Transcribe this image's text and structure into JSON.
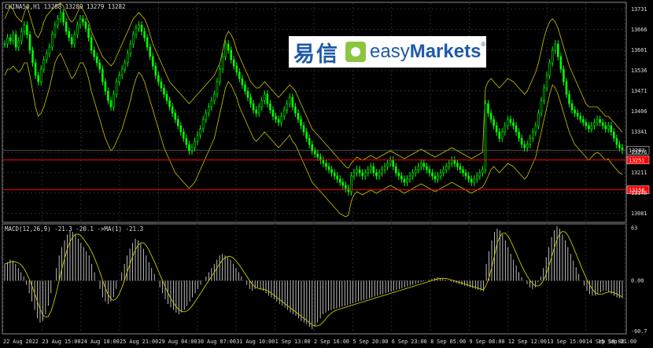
{
  "header": {
    "symbol_info": "CHINA50,H1  13288 13289 13279 13282"
  },
  "macd": {
    "label": "MACD(12,26,9) -21.3 -20.1  ->MA(1) -21.3",
    "ticks": [
      "63",
      "0.00",
      "-60.7"
    ]
  },
  "price_axis": {
    "ticks": [
      "13731",
      "13666",
      "13601",
      "13536",
      "13471",
      "13406",
      "13341",
      "13276",
      "13211",
      "13146",
      "13081"
    ],
    "current_price": "13282",
    "level_1": "13251",
    "level_2": "13156"
  },
  "time_axis": [
    "22 Aug 2022",
    "23 Aug 15:00",
    "24 Aug 18:00",
    "25 Aug 21:00",
    "29 Aug 04:00",
    "30 Aug 07:00",
    "31 Aug 10:00",
    "1 Sep 13:00",
    "2 Sep 16:00",
    "5 Sep 20:00",
    "6 Sep 23:00",
    "8 Sep 05:00",
    "9 Sep 08:00",
    "12 Sep 12:00",
    "13 Sep 15:00",
    "14 Sep 18:00",
    "15 Sep 21:00"
  ],
  "logo": {
    "cn_text": "易信",
    "en_light": "easy",
    "en_bold": "Markets",
    "reg": "®"
  },
  "colors": {
    "bull": "#00ff00",
    "bear": "#00ff00",
    "band": "#c8c800",
    "level": "#ff0000",
    "grid": "#2a2a2a"
  },
  "chart_data": {
    "type": "candlestick",
    "price_range": [
      13055,
      13750
    ],
    "closes": [
      13620,
      13640,
      13630,
      13650,
      13610,
      13630,
      13660,
      13680,
      13650,
      13600,
      13560,
      13520,
      13500,
      13540,
      13570,
      13590,
      13610,
      13650,
      13680,
      13700,
      13720,
      13690,
      13660,
      13640,
      13620,
      13650,
      13680,
      13700,
      13690,
      13670,
      13640,
      13600,
      13580,
      13560,
      13540,
      13500,
      13470,
      13440,
      13420,
      13460,
      13500,
      13520,
      13540,
      13560,
      13590,
      13620,
      13650,
      13670,
      13680,
      13660,
      13640,
      13610,
      13580,
      13550,
      13520,
      13500,
      13480,
      13460,
      13440,
      13420,
      13400,
      13380,
      13360,
      13340,
      13320,
      13300,
      13280,
      13290,
      13310,
      13330,
      13350,
      13380,
      13400,
      13420,
      13440,
      13460,
      13500,
      13540,
      13580,
      13620,
      13600,
      13570,
      13550,
      13530,
      13510,
      13490,
      13470,
      13450,
      13430,
      13410,
      13400,
      13420,
      13440,
      13460,
      13430,
      13410,
      13390,
      13380,
      13370,
      13390,
      13410,
      13430,
      13450,
      13420,
      13400,
      13380,
      13360,
      13340,
      13320,
      13300,
      13280,
      13270,
      13260,
      13250,
      13240,
      13230,
      13220,
      13210,
      13200,
      13190,
      13180,
      13170,
      13160,
      13150,
      13200,
      13210,
      13220,
      13210,
      13200,
      13210,
      13220,
      13230,
      13210,
      13200,
      13210,
      13220,
      13230,
      13240,
      13250,
      13230,
      13210,
      13200,
      13190,
      13180,
      13190,
      13200,
      13210,
      13220,
      13230,
      13240,
      13230,
      13220,
      13210,
      13200,
      13190,
      13200,
      13210,
      13220,
      13230,
      13240,
      13250,
      13240,
      13230,
      13220,
      13210,
      13200,
      13190,
      13180,
      13190,
      13200,
      13210,
      13220,
      13430,
      13400,
      13380,
      13360,
      13340,
      13320,
      13340,
      13360,
      13380,
      13370,
      13360,
      13340,
      13320,
      13300,
      13290,
      13300,
      13320,
      13340,
      13360,
      13400,
      13440,
      13480,
      13520,
      13560,
      13600,
      13620,
      13580,
      13540,
      13500,
      13460,
      13430,
      13410,
      13400,
      13390,
      13380,
      13370,
      13360,
      13350,
      13360,
      13370,
      13380,
      13370,
      13360,
      13350,
      13360,
      13340,
      13320,
      13300,
      13290,
      13282
    ],
    "up_band": [
      13700,
      13720,
      13740,
      13730,
      13710,
      13700,
      13690,
      13720,
      13740,
      13710,
      13680,
      13650,
      13640,
      13660,
      13690,
      13710,
      13720,
      13730,
      13740,
      13745,
      13750,
      13740,
      13720,
      13700,
      13690,
      13700,
      13720,
      13740,
      13730,
      13710,
      13690,
      13660,
      13640,
      13620,
      13600,
      13580,
      13570,
      13560,
      13550,
      13560,
      13580,
      13600,
      13620,
      13640,
      13660,
      13680,
      13700,
      13710,
      13720,
      13710,
      13700,
      13680,
      13650,
      13620,
      13600,
      13580,
      13560,
      13540,
      13520,
      13500,
      13490,
      13480,
      13470,
      13460,
      13450,
      13440,
      13430,
      13440,
      13450,
      13460,
      13470,
      13480,
      13490,
      13500,
      13510,
      13520,
      13540,
      13560,
      13600,
      13640,
      13660,
      13650,
      13630,
      13600,
      13580,
      13560,
      13540,
      13520,
      13500,
      13490,
      13480,
      13480,
      13490,
      13500,
      13490,
      13480,
      13470,
      13460,
      13450,
      13460,
      13470,
      13480,
      13490,
      13480,
      13470,
      13450,
      13430,
      13410,
      13390,
      13370,
      13350,
      13340,
      13330,
      13320,
      13310,
      13300,
      13290,
      13280,
      13270,
      13260,
      13250,
      13240,
      13230,
      13225,
      13240,
      13250,
      13260,
      13255,
      13250,
      13255,
      13260,
      13265,
      13260,
      13255,
      13260,
      13265,
      13270,
      13275,
      13280,
      13275,
      13270,
      13265,
      13260,
      13255,
      13260,
      13265,
      13270,
      13275,
      13280,
      13285,
      13280,
      13275,
      13270,
      13265,
      13260,
      13265,
      13270,
      13275,
      13280,
      13285,
      13290,
      13285,
      13280,
      13275,
      13270,
      13265,
      13260,
      13255,
      13260,
      13265,
      13270,
      13275,
      13480,
      13500,
      13510,
      13500,
      13490,
      13480,
      13490,
      13500,
      13510,
      13505,
      13500,
      13490,
      13480,
      13470,
      13460,
      13470,
      13490,
      13510,
      13530,
      13560,
      13600,
      13640,
      13670,
      13690,
      13700,
      13690,
      13670,
      13640,
      13610,
      13580,
      13550,
      13530,
      13510,
      13490,
      13470,
      13450,
      13430,
      13420,
      13420,
      13420,
      13420,
      13410,
      13400,
      13390,
      13390,
      13380,
      13370,
      13360,
      13350,
      13340
    ],
    "low_band": [
      13520,
      13540,
      13540,
      13550,
      13540,
      13530,
      13540,
      13560,
      13560,
      13520,
      13470,
      13420,
      13390,
      13400,
      13420,
      13450,
      13480,
      13520,
      13560,
      13580,
      13590,
      13570,
      13550,
      13530,
      13510,
      13520,
      13540,
      13560,
      13560,
      13540,
      13510,
      13470,
      13440,
      13410,
      13380,
      13350,
      13320,
      13300,
      13280,
      13290,
      13310,
      13330,
      13350,
      13380,
      13410,
      13440,
      13480,
      13510,
      13530,
      13520,
      13500,
      13470,
      13440,
      13410,
      13380,
      13350,
      13320,
      13290,
      13270,
      13250,
      13230,
      13210,
      13200,
      13190,
      13180,
      13170,
      13160,
      13170,
      13180,
      13200,
      13220,
      13240,
      13260,
      13280,
      13300,
      13320,
      13360,
      13400,
      13440,
      13480,
      13500,
      13490,
      13470,
      13450,
      13420,
      13400,
      13380,
      13360,
      13340,
      13320,
      13310,
      13320,
      13330,
      13340,
      13330,
      13320,
      13310,
      13300,
      13290,
      13300,
      13310,
      13320,
      13330,
      13310,
      13300,
      13280,
      13260,
      13240,
      13220,
      13200,
      13180,
      13170,
      13160,
      13150,
      13140,
      13130,
      13120,
      13110,
      13100,
      13090,
      13080,
      13075,
      13070,
      13075,
      13120,
      13140,
      13150,
      13145,
      13140,
      13145,
      13150,
      13155,
      13150,
      13145,
      13150,
      13155,
      13160,
      13165,
      13170,
      13165,
      13160,
      13155,
      13150,
      13145,
      13150,
      13155,
      13160,
      13165,
      13170,
      13175,
      13170,
      13165,
      13160,
      13155,
      13150,
      13155,
      13160,
      13165,
      13170,
      13175,
      13180,
      13175,
      13170,
      13165,
      13160,
      13155,
      13150,
      13145,
      13150,
      13155,
      13160,
      13165,
      13180,
      13200,
      13220,
      13230,
      13220,
      13210,
      13220,
      13230,
      13240,
      13235,
      13230,
      13220,
      13210,
      13200,
      13190,
      13200,
      13220,
      13240,
      13260,
      13300,
      13340,
      13380,
      13420,
      13460,
      13490,
      13480,
      13460,
      13430,
      13400,
      13370,
      13340,
      13320,
      13300,
      13290,
      13280,
      13270,
      13260,
      13250,
      13260,
      13270,
      13275,
      13270,
      13260,
      13250,
      13255,
      13240,
      13230,
      13220,
      13210,
      13205
    ],
    "macd": [
      20,
      22,
      25,
      24,
      20,
      15,
      10,
      5,
      -5,
      -15,
      -25,
      -35,
      -45,
      -50,
      -48,
      -40,
      -30,
      -15,
      0,
      15,
      30,
      40,
      48,
      55,
      60,
      58,
      55,
      50,
      45,
      40,
      35,
      30,
      20,
      10,
      0,
      -10,
      -20,
      -25,
      -28,
      -25,
      -20,
      -10,
      0,
      10,
      20,
      30,
      38,
      45,
      50,
      48,
      44,
      38,
      30,
      22,
      15,
      8,
      0,
      -8,
      -15,
      -22,
      -28,
      -32,
      -35,
      -38,
      -40,
      -38,
      -35,
      -30,
      -25,
      -20,
      -15,
      -10,
      -5,
      0,
      5,
      10,
      15,
      20,
      25,
      30,
      32,
      30,
      28,
      25,
      20,
      15,
      10,
      5,
      0,
      -5,
      -10,
      -12,
      -10,
      -8,
      -10,
      -12,
      -15,
      -18,
      -20,
      -22,
      -25,
      -28,
      -30,
      -32,
      -35,
      -38,
      -40,
      -42,
      -45,
      -48,
      -50,
      -52,
      -55,
      -58,
      -55,
      -50,
      -45,
      -40,
      -38,
      -36,
      -35,
      -34,
      -33,
      -32,
      -31,
      -30,
      -29,
      -28,
      -27,
      -26,
      -25,
      -24,
      -23,
      -22,
      -21,
      -20,
      -19,
      -18,
      -17,
      -16,
      -15,
      -14,
      -13,
      -12,
      -11,
      -10,
      -9,
      -8,
      -7,
      -6,
      -5,
      -4,
      -3,
      -2,
      -1,
      0,
      1,
      2,
      3,
      4,
      3,
      2,
      1,
      0,
      -1,
      -2,
      -3,
      -4,
      -5,
      -6,
      -7,
      -8,
      -9,
      -10,
      -11,
      -12,
      -13,
      20,
      35,
      48,
      58,
      62,
      60,
      55,
      48,
      40,
      32,
      25,
      18,
      10,
      4,
      0,
      -4,
      -8,
      -10,
      -8,
      -2,
      5,
      15,
      28,
      40,
      52,
      60,
      65,
      62,
      55,
      48,
      40,
      32,
      24,
      16,
      8,
      0,
      -6,
      -12,
      -16,
      -18,
      -18,
      -16,
      -14,
      -12,
      -12,
      -14,
      -16,
      -18,
      -20,
      -21,
      -21.3
    ]
  }
}
